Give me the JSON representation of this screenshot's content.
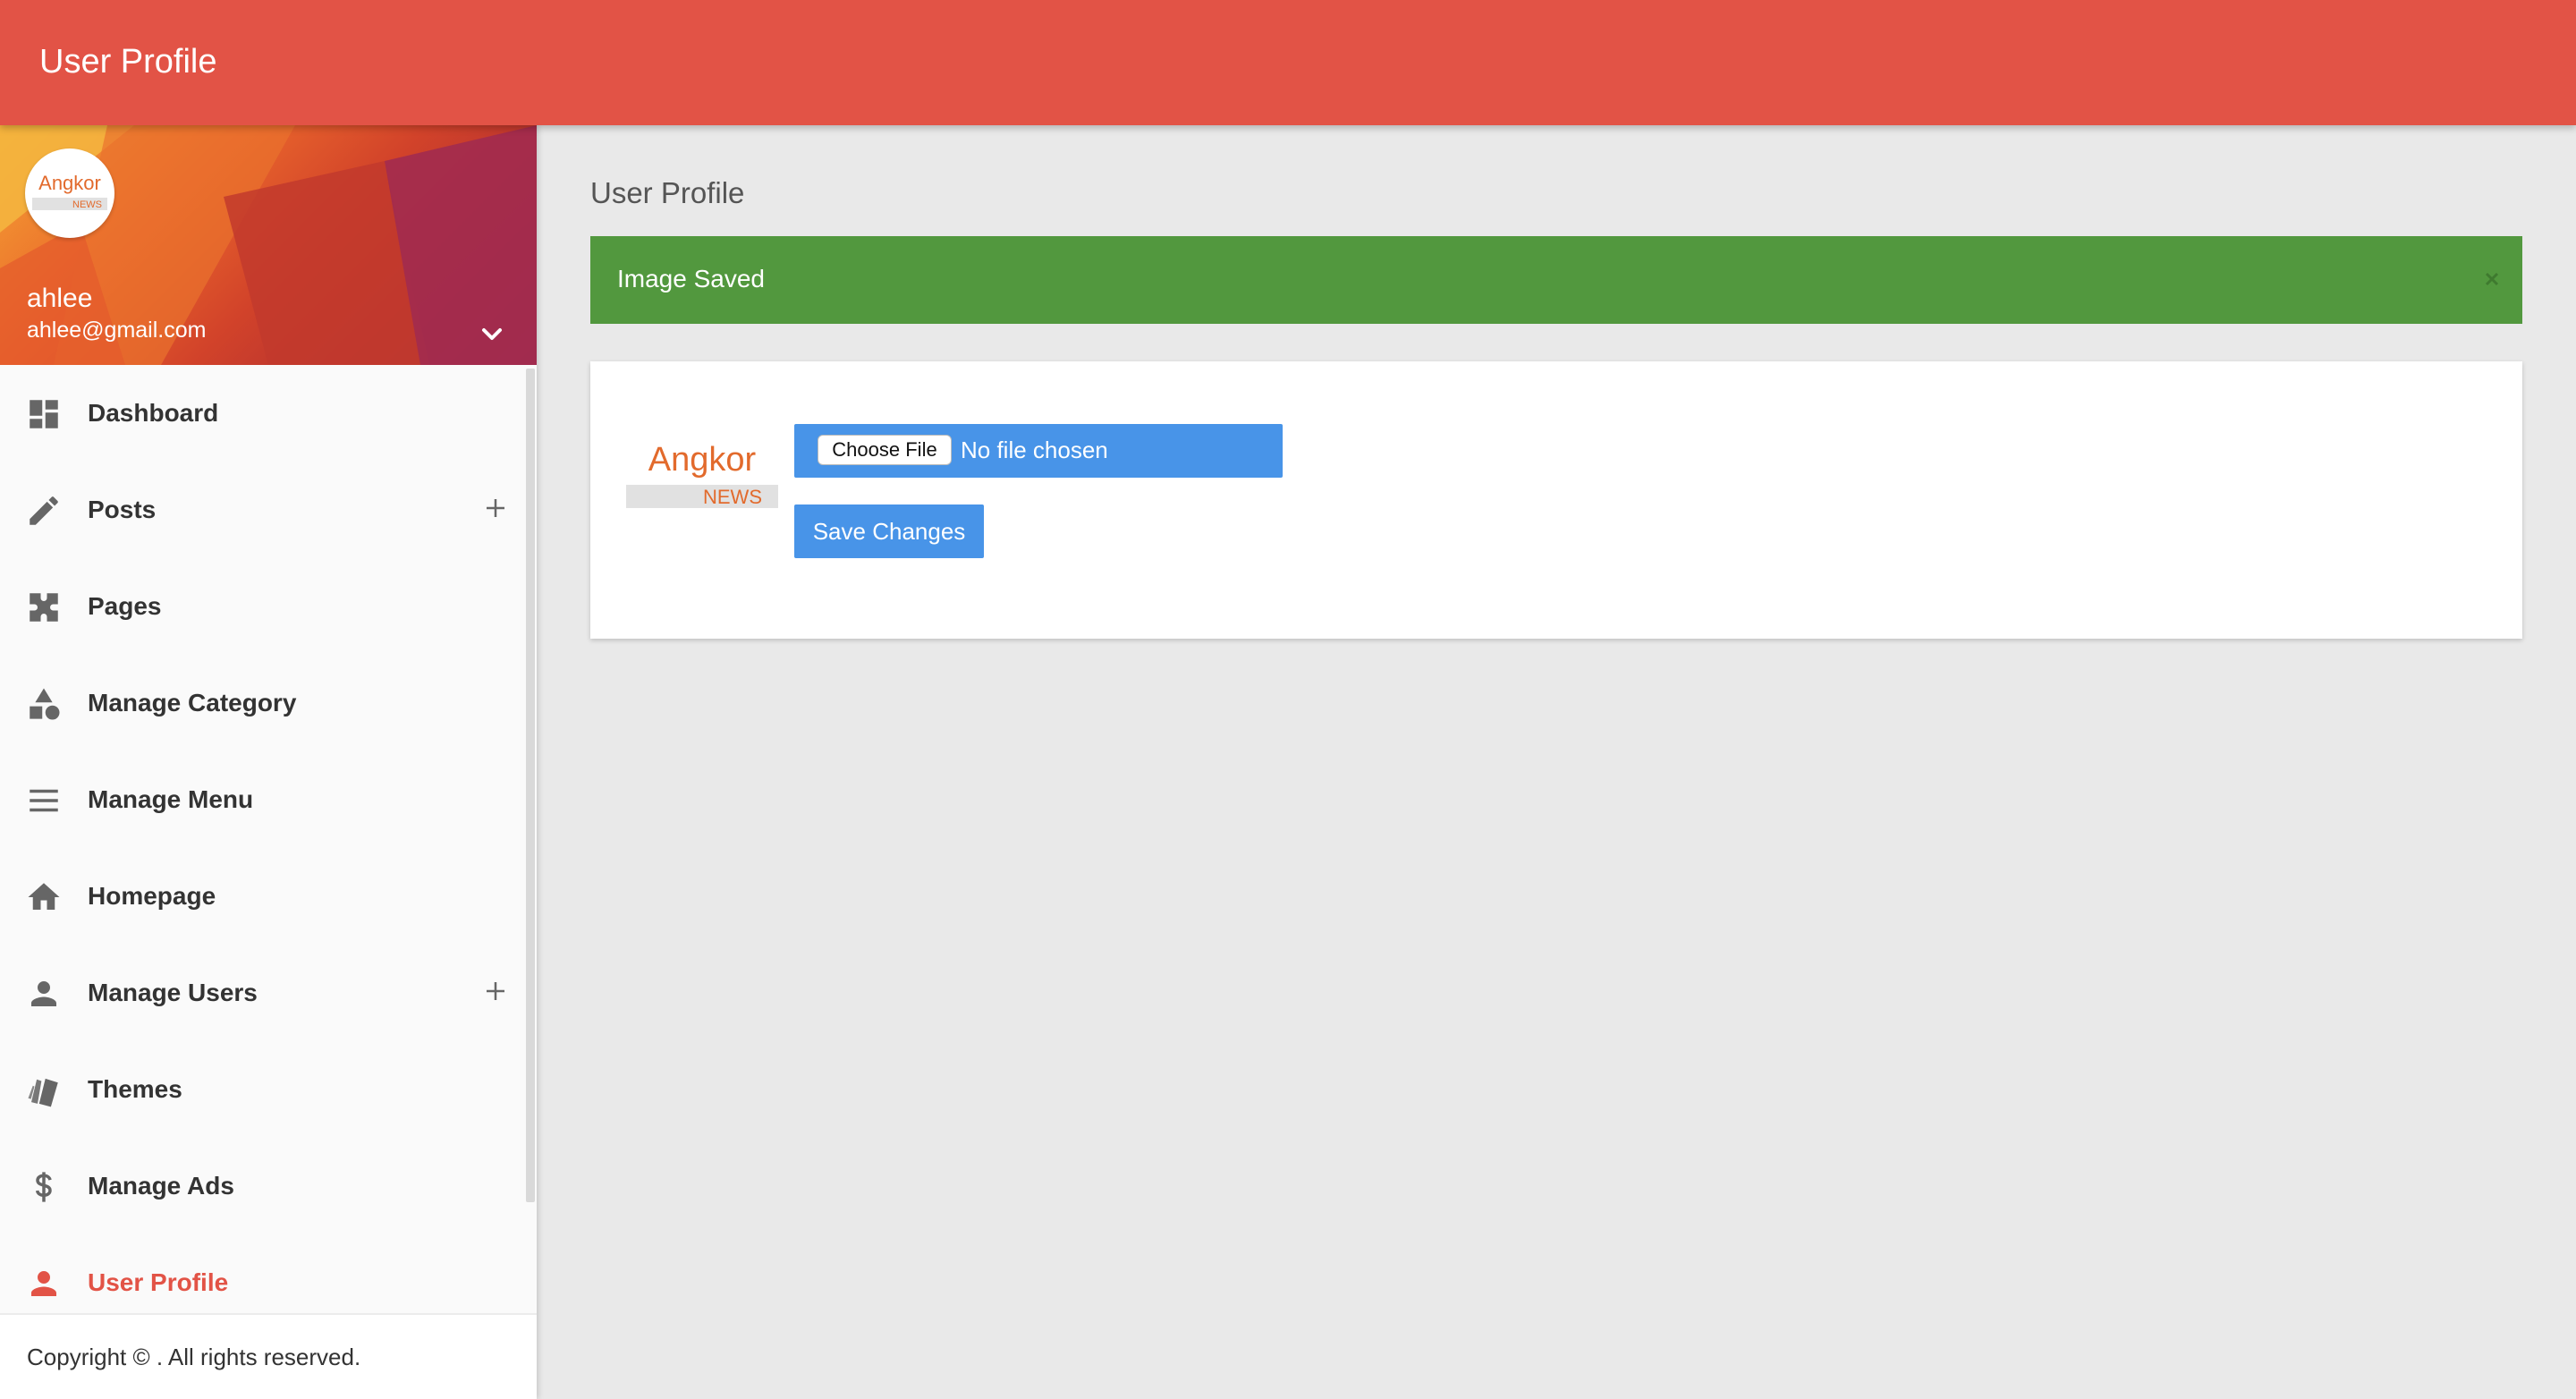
{
  "topbar": {
    "title": "User Profile"
  },
  "user": {
    "name": "ahlee",
    "email": "ahlee@gmail.com",
    "avatar_logo_top": "Angkor",
    "avatar_logo_bottom": "NEWS"
  },
  "sidebar": {
    "items": [
      {
        "label": "Dashboard",
        "icon": "dashboard-icon",
        "expandable": false,
        "active": false
      },
      {
        "label": "Posts",
        "icon": "pencil-icon",
        "expandable": true,
        "active": false
      },
      {
        "label": "Pages",
        "icon": "puzzle-icon",
        "expandable": false,
        "active": false
      },
      {
        "label": "Manage Category",
        "icon": "shapes-icon",
        "expandable": false,
        "active": false
      },
      {
        "label": "Manage Menu",
        "icon": "menu-lines-icon",
        "expandable": false,
        "active": false
      },
      {
        "label": "Homepage",
        "icon": "home-icon",
        "expandable": false,
        "active": false
      },
      {
        "label": "Manage Users",
        "icon": "person-icon",
        "expandable": true,
        "active": false
      },
      {
        "label": "Themes",
        "icon": "swatch-book-icon",
        "expandable": false,
        "active": false
      },
      {
        "label": "Manage Ads",
        "icon": "dollar-icon",
        "expandable": false,
        "active": false
      },
      {
        "label": "User Profile",
        "icon": "person-icon",
        "expandable": false,
        "active": true
      }
    ]
  },
  "footer": {
    "copyright": "Copyright © . All rights reserved."
  },
  "main": {
    "title": "User Profile",
    "alert": {
      "message": "Image Saved"
    },
    "profile_image": {
      "logo_top": "Angkor",
      "logo_bottom": "NEWS"
    },
    "file_input": {
      "button_label": "Choose File",
      "status": "No file chosen"
    },
    "save_label": "Save Changes"
  },
  "colors": {
    "accent": "#e25346",
    "success": "#52983e",
    "primary_button": "#4894e8"
  }
}
